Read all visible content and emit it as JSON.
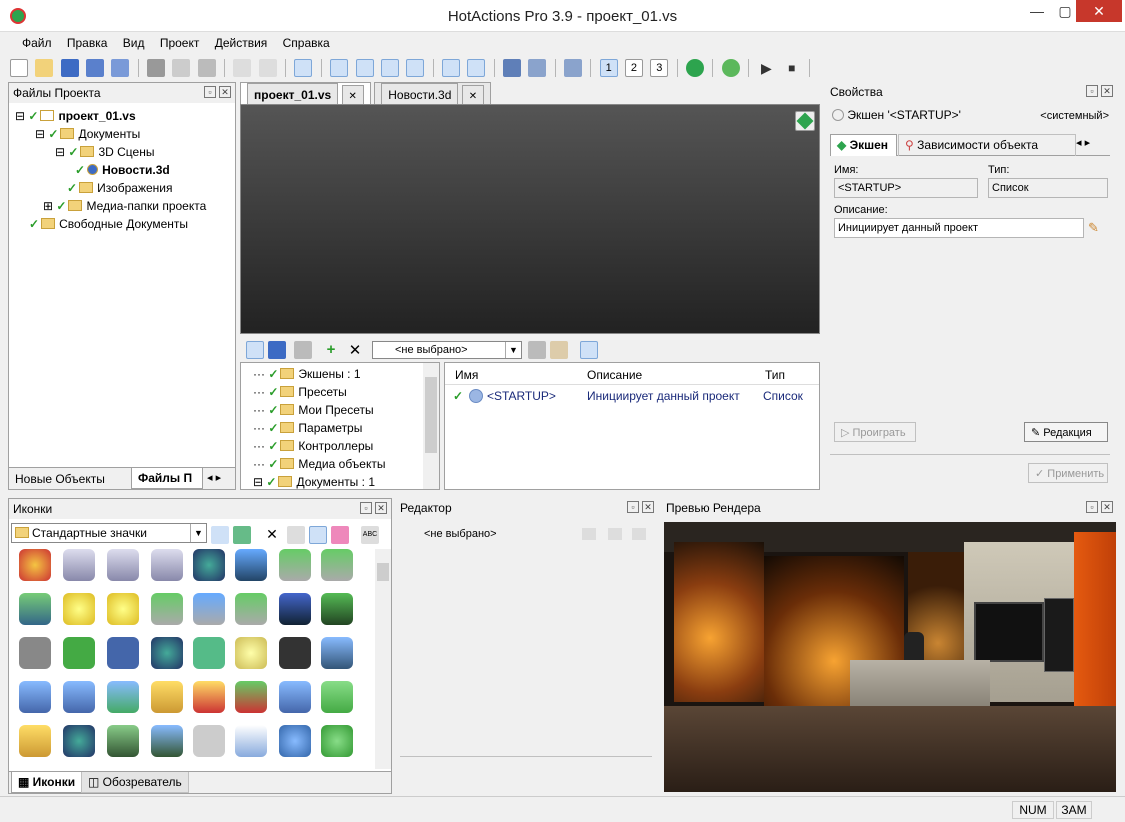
{
  "window": {
    "title": "HotActions Pro 3.9 - проект_01.vs"
  },
  "menu": [
    "Файл",
    "Правка",
    "Вид",
    "Проект",
    "Действия",
    "Справка"
  ],
  "project_panel": {
    "title": "Файлы Проекта",
    "tree": [
      "проект_01.vs",
      "Документы",
      "3D Сцены",
      "Новости.3d",
      "Изображения",
      "Медиа-папки проекта",
      "Свободные Документы"
    ],
    "tabs": [
      "Новые Объекты",
      "Файлы П"
    ]
  },
  "doc_tabs": [
    "проект_01.vs",
    "Новости.3d"
  ],
  "actions_toolbar": {
    "select": "<не выбрано>"
  },
  "actions_tree": [
    "Экшены : 1",
    "Пресеты",
    "Мои Пресеты",
    "Параметры",
    "Контроллеры",
    "Медиа объекты",
    "Документы : 1"
  ],
  "actions_table": {
    "headers": [
      "Имя",
      "Описание",
      "Тип"
    ],
    "rows": [
      {
        "name": "<STARTUP>",
        "desc": "Инициирует данный проект",
        "type": "Список"
      }
    ]
  },
  "properties": {
    "title": "Свойства",
    "action_label": "Экшен '<STARTUP>'",
    "system": "<системный>",
    "tabs": [
      "Экшен",
      "Зависимости объекта"
    ],
    "name_label": "Имя:",
    "name_value": "<STARTUP>",
    "type_label": "Тип:",
    "type_value": "Список",
    "desc_label": "Описание:",
    "desc_value": "Инициирует данный проект",
    "play": "Проиграть",
    "edit": "Редакция",
    "apply": "Применить"
  },
  "icons_panel": {
    "title": "Иконки",
    "select": "Стандартные значки",
    "tabs": [
      "Иконки",
      "Обозреватель"
    ]
  },
  "editor_panel": {
    "title": "Редактор",
    "value": "<не выбрано>"
  },
  "render_panel": {
    "title": "Превью Рендера"
  },
  "status": {
    "num": "NUM",
    "caps": "ЗАМ"
  }
}
